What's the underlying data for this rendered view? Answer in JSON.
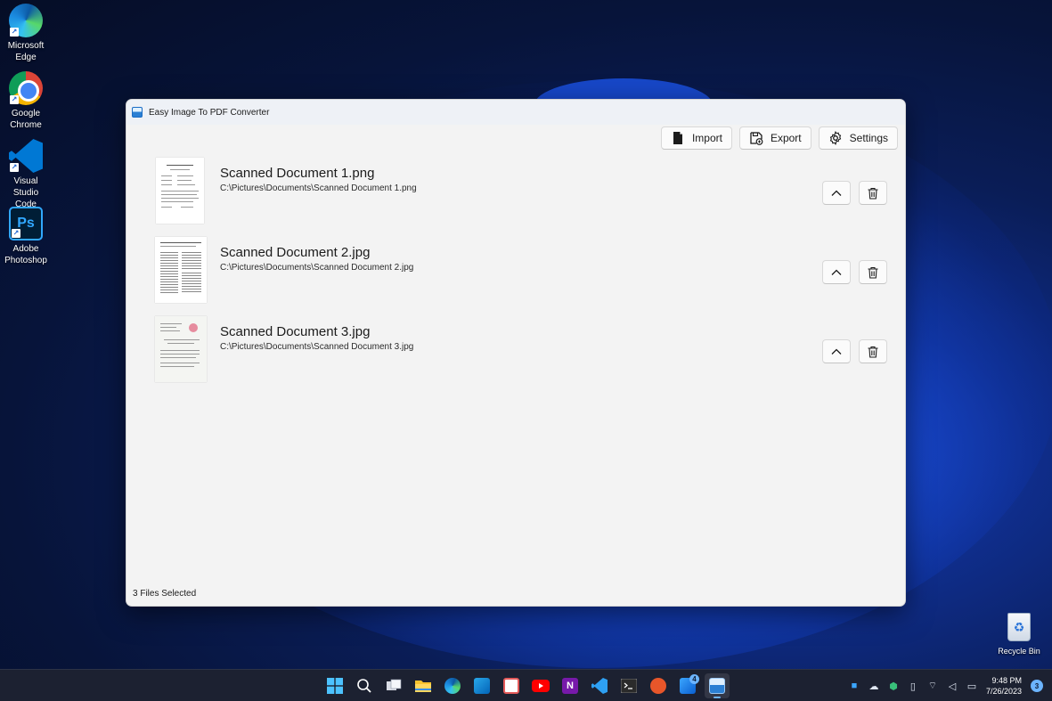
{
  "desktop": {
    "icons": [
      {
        "label_line1": "Microsoft",
        "label_line2": "Edge",
        "icon": "edge-icon"
      },
      {
        "label_line1": "Google",
        "label_line2": "Chrome",
        "icon": "chrome-icon"
      },
      {
        "label_line1": "Visual Studio",
        "label_line2": "Code",
        "icon": "vscode-icon"
      },
      {
        "label_line1": "Adobe",
        "label_line2": "Photoshop",
        "icon": "photoshop-icon",
        "glyph": "Ps"
      }
    ],
    "recycle_bin": "Recycle Bin"
  },
  "window": {
    "title": "Easy Image To PDF Converter",
    "toolbar": {
      "import_label": "Import",
      "export_label": "Export",
      "settings_label": "Settings"
    },
    "files": [
      {
        "name": "Scanned Document 1.png",
        "path": "C:\\Pictures\\Documents\\Scanned Document 1.png"
      },
      {
        "name": "Scanned Document 2.jpg",
        "path": "C:\\Pictures\\Documents\\Scanned Document 2.jpg"
      },
      {
        "name": "Scanned Document 3.jpg",
        "path": "C:\\Pictures\\Documents\\Scanned Document 3.jpg"
      }
    ],
    "status": "3 Files Selected"
  },
  "taskbar": {
    "apps": [
      "start-icon",
      "search-icon",
      "task-view-icon",
      "file-explorer-icon",
      "edge-icon",
      "outlook-icon",
      "snipping-tool-icon",
      "youtube-icon",
      "onenote-icon",
      "vscode-icon",
      "terminal-icon",
      "remote-desktop-icon",
      "store-icon",
      "image-to-pdf-icon"
    ],
    "store_badge": "4",
    "clock_time": "9:48 PM",
    "clock_date": "7/26/2023",
    "notification_count": "3"
  },
  "colors": {
    "accent": "#0067c0",
    "window_bg": "#f3f3f3",
    "taskbar_bg": "#1c2131"
  }
}
